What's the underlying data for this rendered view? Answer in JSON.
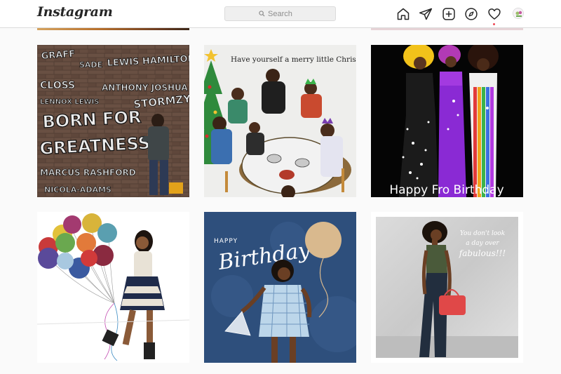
{
  "header": {
    "logo_text": "Instagram",
    "search_placeholder": "Search",
    "icons": [
      "home-icon",
      "direct-icon",
      "new-post-icon",
      "explore-icon",
      "activity-icon",
      "avatar"
    ]
  },
  "posts": [
    {
      "name": "graffiti",
      "texts": [
        "BORN FOR",
        "GREATNESS",
        "SADE",
        "NICOLA-ADAMS",
        "MARCUS RASHFORD",
        "STORMZY"
      ]
    },
    {
      "name": "christmas",
      "texts": [
        "Have yourself a merry little Christmas"
      ]
    },
    {
      "name": "fro-birthday",
      "texts": [
        "Happy Fro Birthday"
      ]
    },
    {
      "name": "balloons",
      "texts": []
    },
    {
      "name": "happy-birthday",
      "texts": [
        "HAPPY",
        "Birthday"
      ]
    },
    {
      "name": "fabulous",
      "texts": [
        "You don't look",
        "a day over",
        "fabulous!!!"
      ]
    }
  ],
  "colors": {
    "accent_notification": "#ed4956",
    "border": "#dbdbdb",
    "background": "#fafafa"
  }
}
